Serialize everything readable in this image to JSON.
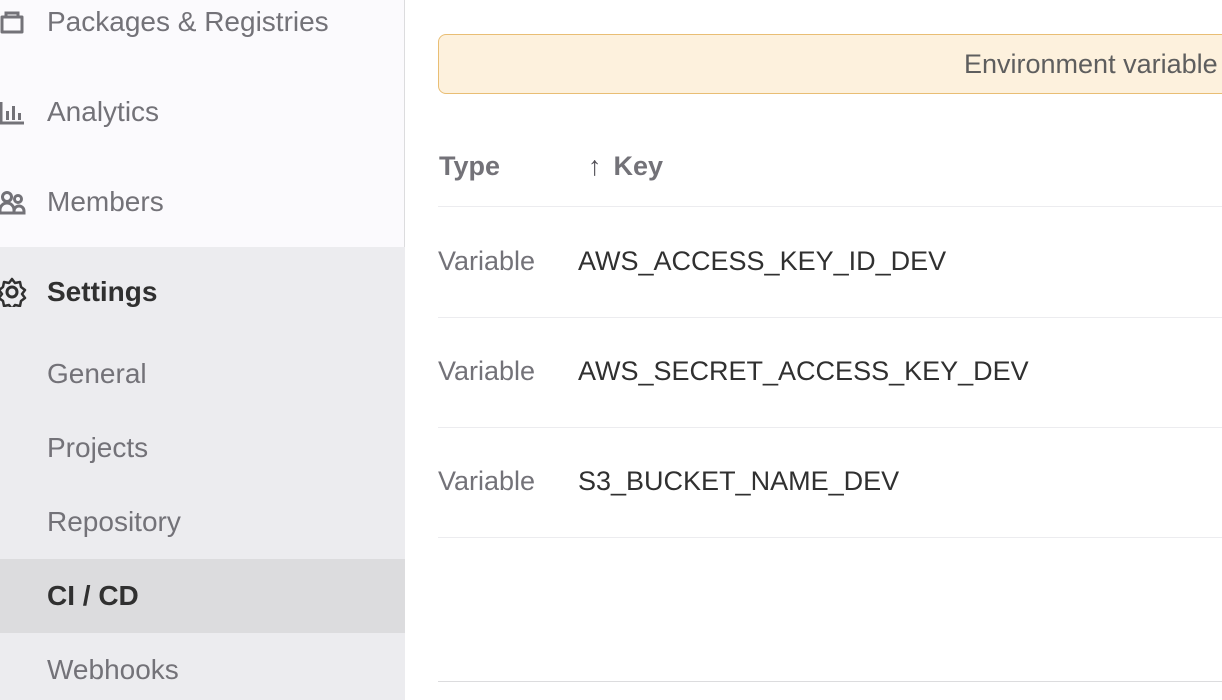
{
  "sidebar": {
    "items": [
      {
        "label": "Packages & Registries",
        "icon": "package-icon"
      },
      {
        "label": "Analytics",
        "icon": "analytics-icon"
      },
      {
        "label": "Members",
        "icon": "users-icon"
      }
    ],
    "settings": {
      "label": "Settings",
      "icon": "settings-icon",
      "subitems": [
        {
          "label": "General"
        },
        {
          "label": "Projects"
        },
        {
          "label": "Repository"
        },
        {
          "label": "CI / CD",
          "active": true
        },
        {
          "label": "Webhooks"
        }
      ]
    }
  },
  "main": {
    "alert": {
      "text": "Environment variable"
    },
    "table": {
      "headers": {
        "type": "Type",
        "key": "Key",
        "sort_indicator": "↑"
      },
      "rows": [
        {
          "type": "Variable",
          "key": "AWS_ACCESS_KEY_ID_DEV"
        },
        {
          "type": "Variable",
          "key": "AWS_SECRET_ACCESS_KEY_DEV"
        },
        {
          "type": "Variable",
          "key": "S3_BUCKET_NAME_DEV"
        }
      ]
    }
  },
  "colors": {
    "alert_bg": "#fdf1dd",
    "alert_border": "#e9be74",
    "active_bg": "#dcdcde",
    "settings_group_bg": "#ececef"
  }
}
